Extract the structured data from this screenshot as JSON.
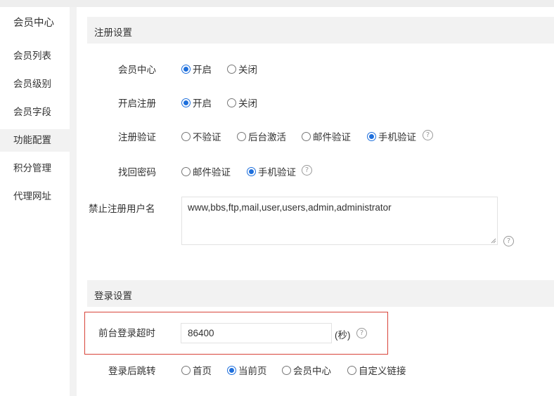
{
  "sidebar": {
    "title": "会员中心",
    "items": [
      {
        "label": "会员列表"
      },
      {
        "label": "会员级别"
      },
      {
        "label": "会员字段"
      },
      {
        "label": "功能配置"
      },
      {
        "label": "积分管理"
      },
      {
        "label": "代理网址"
      }
    ],
    "active": "功能配置"
  },
  "register": {
    "heading": "注册设置",
    "member_center": {
      "label": "会员中心",
      "opt_on": "开启",
      "opt_off": "关闭",
      "selected": "开启"
    },
    "open_register": {
      "label": "开启注册",
      "opt_on": "开启",
      "opt_off": "关闭",
      "selected": "开启"
    },
    "verify": {
      "label": "注册验证",
      "options": [
        "不验证",
        "后台激活",
        "邮件验证",
        "手机验证"
      ],
      "selected": "手机验证"
    },
    "recover": {
      "label": "找回密码",
      "options": [
        "邮件验证",
        "手机验证"
      ],
      "selected": "手机验证"
    },
    "banned": {
      "label": "禁止注册用户名",
      "value": "www,bbs,ftp,mail,user,users,admin,administrator"
    }
  },
  "login": {
    "heading": "登录设置",
    "timeout": {
      "label": "前台登录超时",
      "value": "86400",
      "unit": "(秒)"
    },
    "redirect": {
      "label": "登录后跳转",
      "options": [
        "首页",
        "当前页",
        "会员中心",
        "自定义链接"
      ],
      "selected": "当前页"
    }
  },
  "colors": {
    "accent": "#1e6fdc",
    "highlight_border": "#d8443a"
  },
  "icons": {
    "help": "question-circle-icon"
  }
}
